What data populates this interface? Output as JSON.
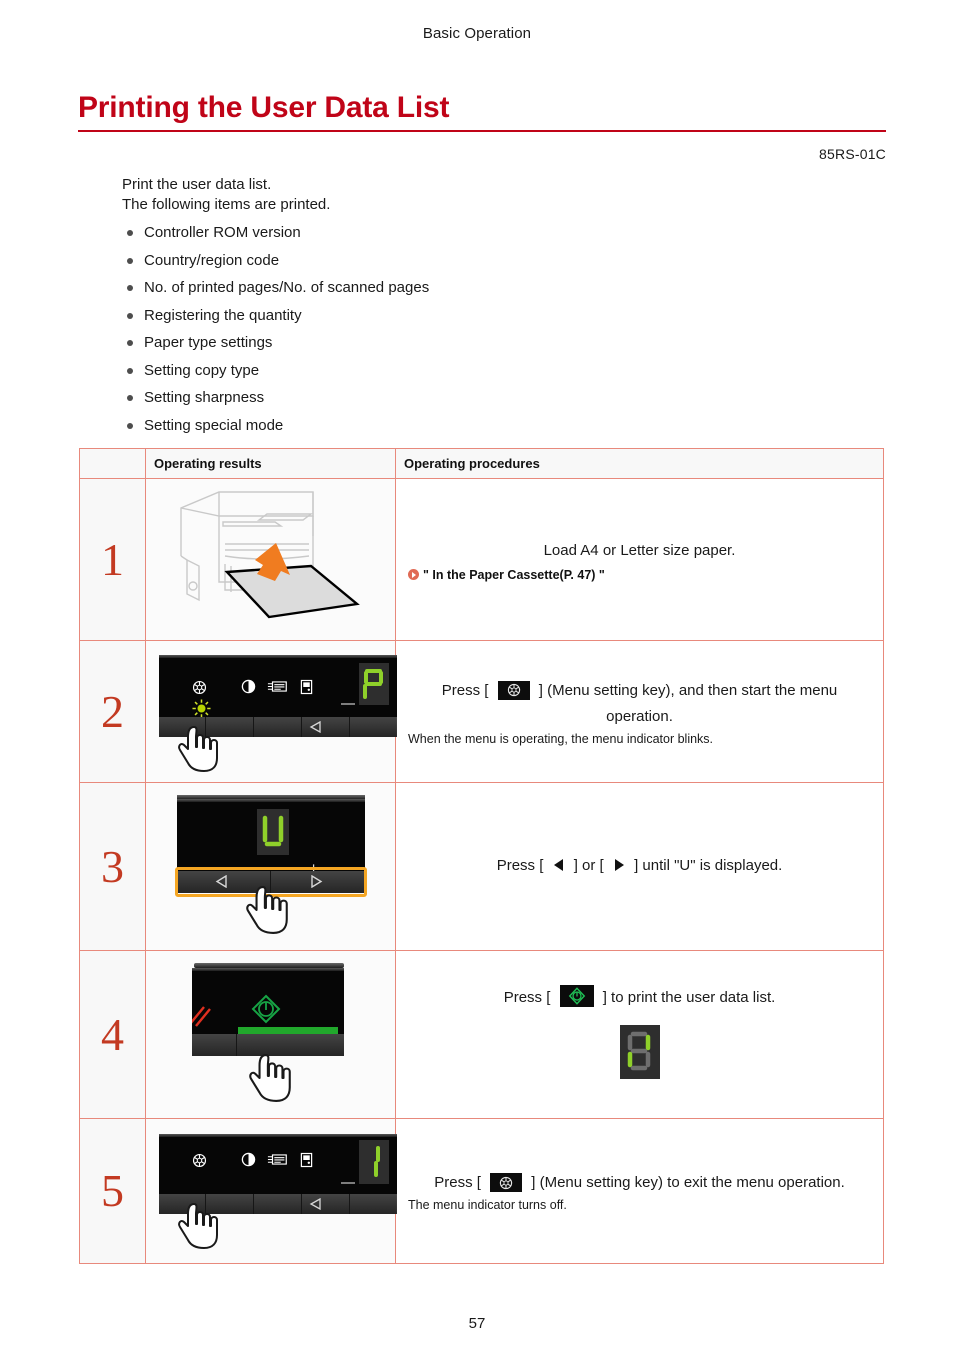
{
  "header": {
    "running_head": "Basic Operation"
  },
  "document": {
    "title": "Printing the User Data List",
    "doc_code": "85RS-01C",
    "page_number": "57",
    "accent_color": "#c00418",
    "table_border_color": "#e8897c",
    "step_number_color": "#c33a22"
  },
  "intro": {
    "line1": "Print the user data list.",
    "line2": "The following items are printed.",
    "items": [
      "Controller ROM version",
      "Country/region code",
      "No. of printed pages/No. of scanned pages",
      "Registering the quantity",
      "Paper type settings",
      "Setting copy type",
      "Setting sharpness",
      "Setting special mode"
    ]
  },
  "table": {
    "headers": {
      "col_number": "",
      "col_results": "Operating results",
      "col_procedures": "Operating procedures"
    },
    "rows": [
      {
        "number": "1",
        "illustration": "printer-paper-cassette-illustration",
        "proc_line1": "Load A4 or Letter size paper.",
        "proc_line2": "",
        "ref_link": "\" In the Paper Cassette(P. 47) \"",
        "note": ""
      },
      {
        "number": "2",
        "illustration": "control-panel-menu-key-illustration",
        "display_value": "P",
        "proc_line1": "Press [",
        "proc_key": "menu-setting-key-icon",
        "proc_line2": "] (Menu setting key), and then start the menu",
        "proc_line3": "operation.",
        "note": "When the menu is operating, the menu indicator blinks."
      },
      {
        "number": "3",
        "illustration": "control-panel-arrow-keys-illustration",
        "display_value": "U",
        "minus_label": "−",
        "plus_label": "+",
        "proc_text_a": "Press [",
        "proc_text_b": "] or [",
        "proc_text_c": "] until \"U\" is displayed.",
        "note": ""
      },
      {
        "number": "4",
        "illustration": "control-panel-start-key-illustration",
        "proc_text_a": "Press [",
        "proc_text_b": "] to print the user data list.",
        "display_value": "8",
        "note": ""
      },
      {
        "number": "5",
        "illustration": "control-panel-exit-menu-illustration",
        "display_value": "1",
        "proc_text_a": "Press [",
        "proc_text_b": "] (Menu setting key) to exit the menu operation.",
        "note": "The menu indicator turns off."
      }
    ]
  }
}
